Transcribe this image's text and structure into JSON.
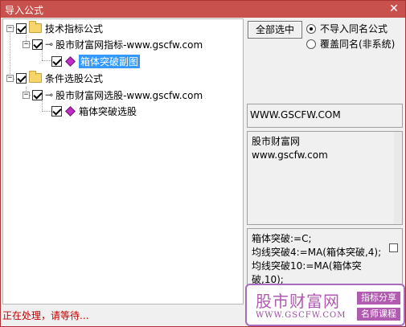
{
  "window": {
    "title": "导入公式",
    "close_glyph": "✕"
  },
  "tree": {
    "categories": [
      {
        "label": "技术指标公式",
        "sources": [
          {
            "label": "股市财富网指标-www.gscfw.com",
            "formulas": [
              {
                "label": "箱体突破副图",
                "selected": true
              }
            ]
          }
        ]
      },
      {
        "label": "条件选股公式",
        "sources": [
          {
            "label": "股市财富网选股-www.gscfw.com",
            "formulas": [
              {
                "label": "箱体突破选股",
                "selected": false
              }
            ]
          }
        ]
      }
    ]
  },
  "controls": {
    "select_all_label": "全部选中",
    "option_skip": "不导入同名公式",
    "option_overwrite": "覆盖同名(非系统)",
    "selected_option": "option_skip"
  },
  "info": {
    "website": "WWW.GSCFW.COM",
    "description_lines": [
      "股市财富网",
      "www.gscfw.com"
    ],
    "formula_lines": [
      "箱体突破:=C;",
      "均线突破4:=MA(箱体突破,4);",
      "均线突破10:=MA(箱体突",
      "破,10);"
    ]
  },
  "status": "正在处理，请等待...",
  "watermark": {
    "name": "股市财富网",
    "url": "WWW.GSCFW.COM",
    "tag1": "指标分享",
    "tag2": "名师课程"
  },
  "colors": {
    "title_bar": "#c8514e",
    "selection": "#3399ff",
    "status_text": "#c00000",
    "watermark": "#b05ab0"
  }
}
